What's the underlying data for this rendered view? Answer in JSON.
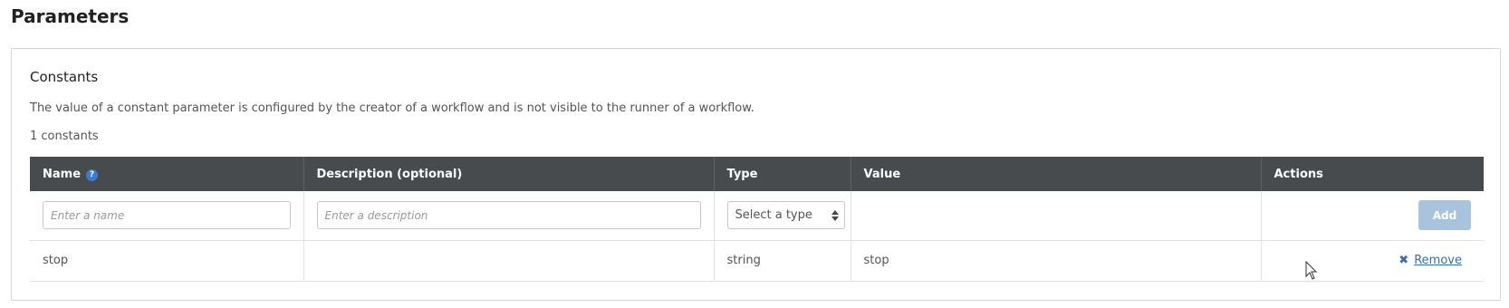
{
  "page": {
    "title": "Parameters"
  },
  "constants": {
    "title": "Constants",
    "description": "The value of a constant parameter is configured by the creator of a workflow and is not visible to the runner of a workflow.",
    "count_label": "1 constants",
    "columns": [
      "Name",
      "Description (optional)",
      "Type",
      "Value",
      "Actions"
    ],
    "new_row": {
      "name_placeholder": "Enter a name",
      "description_placeholder": "Enter a description",
      "type_select": "Select a type",
      "add_label": "Add"
    },
    "rows": [
      {
        "name": "stop",
        "description": "",
        "type": "string",
        "value": "stop",
        "action_label": "Remove"
      }
    ]
  },
  "icons": {
    "help": "question-circle-icon",
    "remove": "x-icon",
    "select": "sort-arrows-icon"
  },
  "colors": {
    "header_bg": "#484b4e",
    "add_button": "#a9c2de",
    "link": "#3a6ea5",
    "help_icon": "#3a7bd5"
  }
}
